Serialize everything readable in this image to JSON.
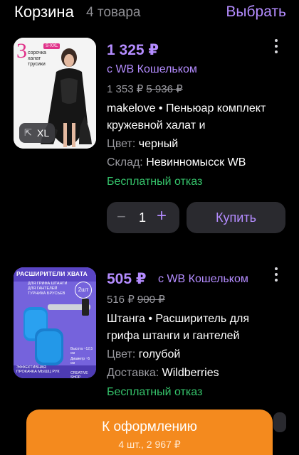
{
  "header": {
    "title": "Корзина",
    "count": "4 товара",
    "select": "Выбрать"
  },
  "items": [
    {
      "price": "1 325 ₽",
      "wallet": "с WB Кошельком",
      "price_old": "1 353 ₽",
      "price_orig": "5 936 ₽",
      "name": "makelove • Пеньюар комплект кружевной халат и",
      "color_key": "Цвет:",
      "color_val": "черный",
      "stock_key": "Склад:",
      "stock_val": "Невинномысск WB",
      "refund": "Бесплатный отказ",
      "qty": "1",
      "buy": "Купить",
      "image": {
        "badge_num": "3",
        "badge_lines": [
          "сорочка",
          "халат",
          "трусики"
        ],
        "size_tag": "S-XXL",
        "size_label": "XL"
      }
    },
    {
      "price": "505 ₽",
      "wallet": "с WB Кошельком",
      "price_old": "516 ₽",
      "price_orig": "900 ₽",
      "name": "Штанга • Расширитель для грифа штанги и гантелей",
      "color_key": "Цвет:",
      "color_val": "голубой",
      "stock_key": "Доставка:",
      "stock_val": "Wildberries",
      "refund": "Бесплатный отказ",
      "image": {
        "banner": "РАСШИРИТЕЛИ ХВАТА",
        "tags": [
          "ДЛЯ ГРИФА ШТАНГИ",
          "ДЛЯ ГАНТЕЛЕЙ",
          "ТУРНИКА БРУСЬЕВ"
        ],
        "pcs": "2шт",
        "dim1": "Высота ~12,5 см",
        "dim2": "Диаметр ~5 см",
        "footer": "ЭФФЕКТИВНАЯ ПРОКАЧКА МЫШЦ РУК",
        "brand": "CREATIVE SHOP"
      }
    }
  ],
  "checkout": {
    "label": "К оформлению",
    "summary": "4 шт., 2 967 ₽"
  },
  "colors": {
    "accent": "#b48cff",
    "green": "#35c46b",
    "orange": "#f48a1e",
    "bg": "#000000"
  }
}
